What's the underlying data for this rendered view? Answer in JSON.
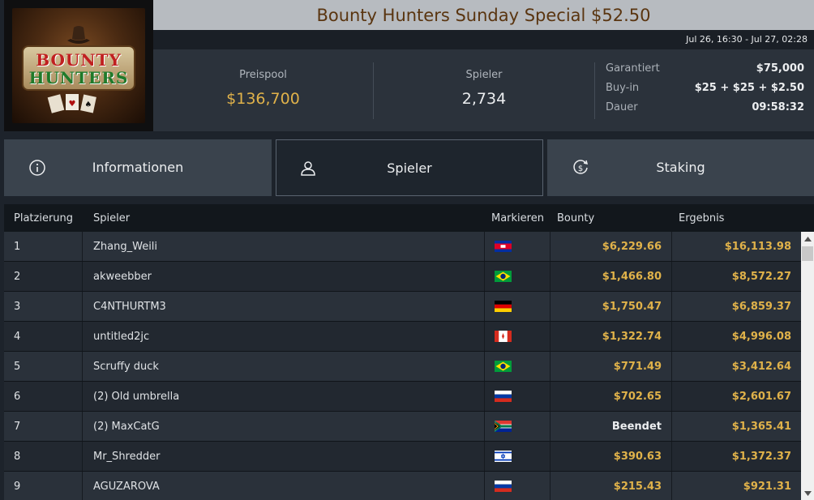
{
  "header": {
    "title": "Bounty Hunters Sunday Special $52.50",
    "date_range": "Jul 26, 16:30 - Jul 27, 02:28",
    "logo_line1": "BOUNTY",
    "logo_line2": "HUNTERS"
  },
  "stats": {
    "prizepool_label": "Preispool",
    "prizepool_value": "$136,700",
    "players_label": "Spieler",
    "players_value": "2,734",
    "details": [
      {
        "label": "Garantiert",
        "value": "$75,000"
      },
      {
        "label": "Buy-in",
        "value": "$25 + $25 + $2.50"
      },
      {
        "label": "Dauer",
        "value": "09:58:32"
      }
    ]
  },
  "tabs": [
    {
      "label": "Informationen",
      "icon": "info-icon",
      "active": false
    },
    {
      "label": "Spieler",
      "icon": "user-icon",
      "active": true
    },
    {
      "label": "Staking",
      "icon": "dollar-refresh-icon",
      "active": false
    }
  ],
  "table": {
    "columns": [
      "Platzierung",
      "Spieler",
      "Markieren",
      "Bounty",
      "Ergebnis"
    ],
    "rows": [
      {
        "rank": "1",
        "player": "Zhang_Weili",
        "flag": "cambodia",
        "bounty": "$6,229.66",
        "result": "$16,113.98"
      },
      {
        "rank": "2",
        "player": "akweebber",
        "flag": "brazil",
        "bounty": "$1,466.80",
        "result": "$8,572.27"
      },
      {
        "rank": "3",
        "player": "C4NTHURTM3",
        "flag": "germany",
        "bounty": "$1,750.47",
        "result": "$6,859.37"
      },
      {
        "rank": "4",
        "player": "untitled2jc",
        "flag": "canada",
        "bounty": "$1,322.74",
        "result": "$4,996.08"
      },
      {
        "rank": "5",
        "player": "Scruffy duck",
        "flag": "brazil",
        "bounty": "$771.49",
        "result": "$3,412.64"
      },
      {
        "rank": "6",
        "player": "(2) Old umbrella",
        "flag": "russia",
        "bounty": "$702.65",
        "result": "$2,601.67"
      },
      {
        "rank": "7",
        "player": "(2) MaxCatG",
        "flag": "south-africa",
        "bounty": "Beendet",
        "result": "$1,365.41"
      },
      {
        "rank": "8",
        "player": "Mr_Shredder",
        "flag": "israel",
        "bounty": "$390.63",
        "result": "$1,372.37"
      },
      {
        "rank": "9",
        "player": "AGUZAROVA",
        "flag": "russia",
        "bounty": "$215.43",
        "result": "$921.31"
      }
    ]
  },
  "colors": {
    "accent_gold": "#e0b24a",
    "title_text": "#5a3510"
  }
}
